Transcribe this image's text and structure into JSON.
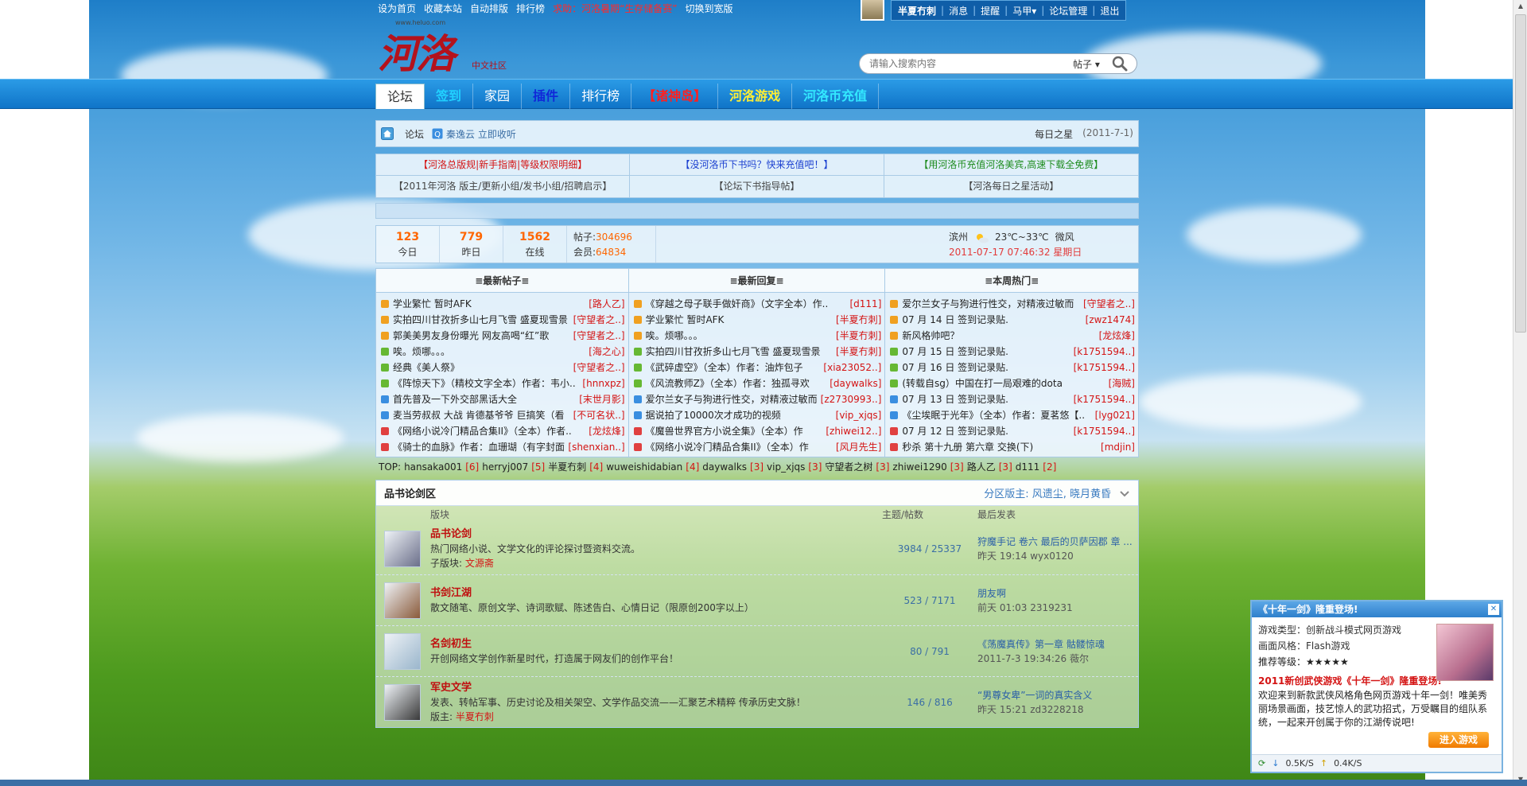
{
  "toplinks": [
    {
      "label": "设为首页",
      "hot": false
    },
    {
      "label": "收藏本站",
      "hot": false
    },
    {
      "label": "自动排版",
      "hot": false
    },
    {
      "label": "排行榜",
      "hot": false
    },
    {
      "label": "求助：河洛暑期“生存储备赛”",
      "hot": true
    },
    {
      "label": "切换到宽版",
      "hot": false
    }
  ],
  "logo": {
    "brand": "河洛",
    "tagline": "中文社区",
    "url": "www.heluo.com"
  },
  "user": {
    "name": "半夏冇刺",
    "menu": [
      "消息",
      "提醒",
      "马甲▾",
      "论坛管理",
      "退出"
    ]
  },
  "search": {
    "placeholder": "请输入搜索内容",
    "type": "帖子"
  },
  "nav": [
    {
      "label": "论坛",
      "color": "#333333",
      "active": true
    },
    {
      "label": "签到",
      "color": "#21d0ff",
      "active": false
    },
    {
      "label": "家园",
      "color": "#ffffff",
      "active": false
    },
    {
      "label": "插件",
      "color": "#1028d8",
      "active": false
    },
    {
      "label": "排行榜",
      "color": "#ffffff",
      "active": false
    },
    {
      "label": "【诸神岛】",
      "color": "#ff2020",
      "active": false
    },
    {
      "label": "河洛游戏",
      "color": "#ffee33",
      "active": false
    },
    {
      "label": "河洛币充值",
      "color": "#33e8ff",
      "active": false
    }
  ],
  "breadcrumb": {
    "home": "论坛",
    "radio": "秦逸云 立即收听",
    "star_label": "每日之星",
    "star_date": "(2011-7-1)"
  },
  "notices": [
    {
      "text": "【河洛总版规|新手指南|等级权限明细】",
      "color": "red"
    },
    {
      "text": "【没河洛币下书吗？快来充值吧！】",
      "color": "blue"
    },
    {
      "text": "【用河洛币充值河洛美宾,高速下载全免费】",
      "color": "green"
    },
    {
      "text": "【2011年河洛 版主/更新小组/发书小组/招聘启示】",
      "color": ""
    },
    {
      "text": "【论坛下书指导帖】",
      "color": ""
    },
    {
      "text": "【河洛每日之星活动】",
      "color": ""
    }
  ],
  "stats": {
    "today": {
      "num": "123",
      "label": "今日"
    },
    "yesterday": {
      "num": "779",
      "label": "昨日"
    },
    "online": {
      "num": "1562",
      "label": "在线"
    },
    "posts_label": "帖子:",
    "posts": "304696",
    "members_label": "会员:",
    "members": "64834",
    "weather_city": "滨州",
    "weather_temp": "23℃~33℃",
    "weather_wind": "微风",
    "datetime": "2011-07-17 07:46:32 星期日"
  },
  "latest_posts": {
    "title": "≡最新帖子≡",
    "items": [
      {
        "t": "学业繁忙 暂时AFK",
        "a": "[路人乙]",
        "c": "#f0a020"
      },
      {
        "t": "实拍四川甘孜折多山七月飞雪 盛夏现雪景",
        "a": "[守望者之..]",
        "c": "#f0a020"
      },
      {
        "t": "郭美美男友身份曝光 网友高喝“红”歌",
        "a": "[守望者之..]",
        "c": "#f0a020"
      },
      {
        "t": "唉。烦哪。。。",
        "a": "[海之心]",
        "c": "#66b833"
      },
      {
        "t": "经典《美人祭》",
        "a": "[守望者之..]",
        "c": "#66b833"
      },
      {
        "t": "《阵惊天下》（精校文字全本）作者：韦小..",
        "a": "[hnnxpz]",
        "c": "#66b833"
      },
      {
        "t": "首先普及一下外交部黑话大全",
        "a": "[末世月影]",
        "c": "#3a8ee0"
      },
      {
        "t": "麦当劳叔叔 大战 肯德基爷爷 巨搞笑（看",
        "a": "[不可名状..]",
        "c": "#3a8ee0"
      },
      {
        "t": "《网络小说冷门精品合集II》（全本）作者..",
        "a": "[龙炫烽]",
        "c": "#e04040"
      },
      {
        "t": "《骑士的血脉》作者：血珊瑚（有字封面",
        "a": "[shenxian..]",
        "c": "#e04040"
      }
    ]
  },
  "latest_replies": {
    "title": "≡最新回复≡",
    "items": [
      {
        "t": "《穿越之母子联手做奸商》（文字全本）作..",
        "a": "[d111]",
        "c": "#f0a020"
      },
      {
        "t": "学业繁忙 暂时AFK",
        "a": "[半夏冇刺]",
        "c": "#f0a020"
      },
      {
        "t": "唉。烦哪。。。",
        "a": "[半夏冇刺]",
        "c": "#f0a020"
      },
      {
        "t": "实拍四川甘孜折多山七月飞雪 盛夏现雪景",
        "a": "[半夏冇刺]",
        "c": "#66b833"
      },
      {
        "t": "《武碎虚空》（全本）作者：油炸包子",
        "a": "[xia23052..]",
        "c": "#66b833"
      },
      {
        "t": "《风流教师Z》（全本）作者：独孤寻欢",
        "a": "[daywalks]",
        "c": "#66b833"
      },
      {
        "t": "爱尔兰女子与狗进行性交，对精液过敏而",
        "a": "[z2730993..]",
        "c": "#3a8ee0"
      },
      {
        "t": "据说拍了10000次才成功的视频",
        "a": "[vip_xjqs]",
        "c": "#3a8ee0"
      },
      {
        "t": "《魔兽世界官方小说全集》（全本）作",
        "a": "[zhiwei12..]",
        "c": "#e04040"
      },
      {
        "t": "《网络小说冷门精品合集II》（全本）作",
        "a": "[风月先生]",
        "c": "#e04040"
      }
    ]
  },
  "weekly_hot": {
    "title": "≡本周热门≡",
    "items": [
      {
        "t": "爱尔兰女子与狗进行性交，对精液过敏而",
        "a": "[守望者之..]",
        "c": "#f0a020"
      },
      {
        "t": "07 月 14 日 签到记录贴.",
        "a": "[zwz1474]",
        "c": "#f0a020"
      },
      {
        "t": "新风格帅吧？",
        "a": "[龙炫烽]",
        "c": "#f0a020"
      },
      {
        "t": "07 月 15 日 签到记录贴.",
        "a": "[k1751594..]",
        "c": "#66b833"
      },
      {
        "t": "07 月 16 日 签到记录贴.",
        "a": "[k1751594..]",
        "c": "#66b833"
      },
      {
        "t": "(转载自sg）中国在打一局艰难的dota",
        "a": "[海贼]",
        "c": "#66b833"
      },
      {
        "t": "07 月 13 日 签到记录贴.",
        "a": "[k1751594..]",
        "c": "#3a8ee0"
      },
      {
        "t": "《尘埃眠于光年》（全本）作者：夏茗悠【..",
        "a": "[lyg021]",
        "c": "#3a8ee0"
      },
      {
        "t": "07 月 12 日 签到记录贴.",
        "a": "[k1751594..]",
        "c": "#e04040"
      },
      {
        "t": "秒杀 第十九册 第六章 交换(下)",
        "a": "[mdjin]",
        "c": "#e04040"
      }
    ]
  },
  "top_users_label": "TOP:",
  "top_users": [
    {
      "name": "hansaka001",
      "count": "[6]"
    },
    {
      "name": "herryj007",
      "count": "[5]"
    },
    {
      "name": "半夏冇刺",
      "count": "[4]"
    },
    {
      "name": "wuweishidabian",
      "count": "[4]"
    },
    {
      "name": "daywalks",
      "count": "[3]"
    },
    {
      "name": "vip_xjqs",
      "count": "[3]"
    },
    {
      "name": "守望者之树",
      "count": "[3]"
    },
    {
      "name": "zhiwei1290",
      "count": "[3]"
    },
    {
      "name": "路人乙",
      "count": "[3]"
    },
    {
      "name": "d111",
      "count": "[2]"
    }
  ],
  "board": {
    "title": "品书论剑区",
    "mods": "分区版主: 风遗尘, 晓月黄昏",
    "col_forum": "版块",
    "col_count": "主题/帖数",
    "col_last": "最后发表",
    "forums": [
      {
        "name": "品书论剑",
        "desc": "热门网络小说、文学文化的评论探讨暨资料交流。",
        "sub_label": "子版块:",
        "sub": "文源斋",
        "count": "3984 / 25337",
        "last_title": "狩魔手记 卷六 最后的贝萨因郡 章 ...",
        "last_user": "昨天 19:14 wyx0120",
        "icolor": "#6b6f8a"
      },
      {
        "name": "书剑江湖",
        "desc": "散文随笔、原创文学、诗词歌赋、陈述告白、心情日记（限原创200字以上）",
        "sub_label": "",
        "sub": "",
        "count": "523 / 7171",
        "last_title": "朋友啊",
        "last_user": "前天 01:03 2319231",
        "icolor": "#8a5a3a"
      },
      {
        "name": "名剑初生",
        "desc": "开创网络文学创作新星时代，打造属于网友们的创作平台！",
        "sub_label": "",
        "sub": "",
        "count": "80 / 791",
        "last_title": "《荡魔真传》第一章 骷髅惊魂",
        "last_user": "2011-7-3 19:34:26 薇尔",
        "icolor": "#9ab6cc"
      },
      {
        "name": "军史文学",
        "desc": "发表、转帖军事、历史讨论及相关架空、文学作品交流——汇聚艺术精粹 传承历史文脉！",
        "sub_label": "版主:",
        "sub": "半夏冇刺",
        "count": "146 / 816",
        "last_title": "“男尊女卑”一词的真实含义",
        "last_user": "昨天 15:21 zd3228218",
        "icolor": "#3a3a3a"
      }
    ]
  },
  "popup": {
    "title": "《十年一剑》隆重登场!",
    "type_line": "游戏类型：创新战斗模式网页游戏",
    "style_line": "画面风格：Flash游戏",
    "rating_line": "推荐等级：★★★★★",
    "headline": "2011新创武侠游戏《十年一剑》隆重登场!",
    "desc": "欢迎来到新款武侠风格角色网页游戏十年一剑！唯美秀丽场景画面，技艺惊人的武功招式，万受瞩目的组队系统，一起来开创属于你的江湖传说吧!",
    "button": "进入游戏",
    "down": "0.5K/S",
    "up": "0.4K/S"
  }
}
